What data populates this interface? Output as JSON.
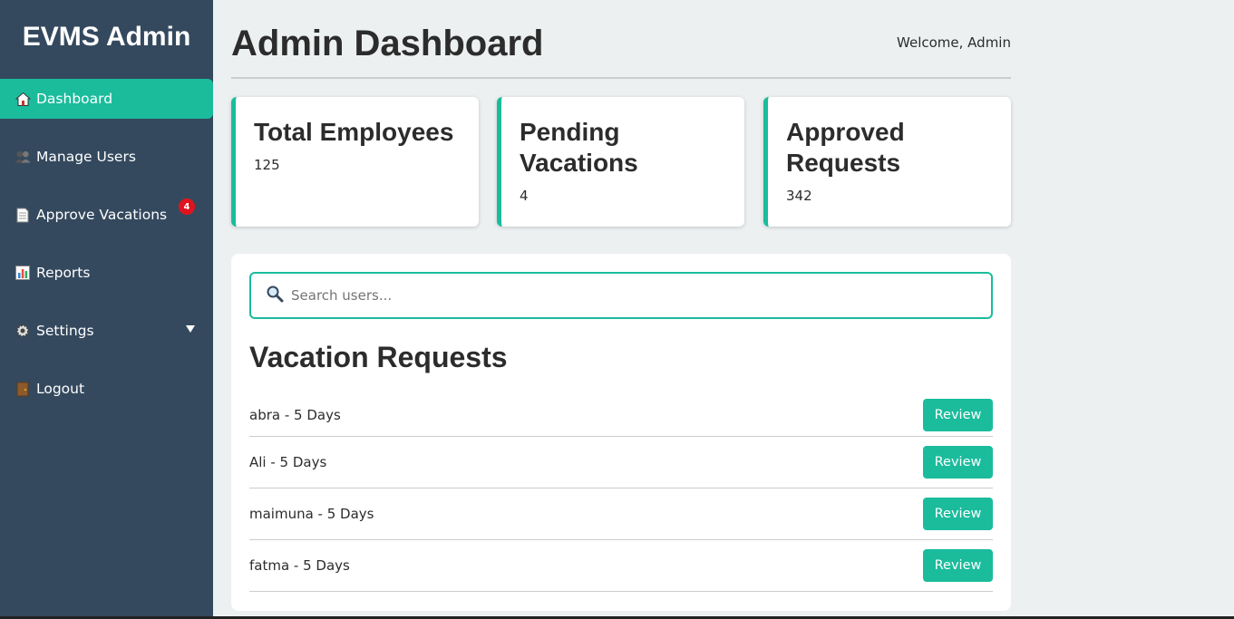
{
  "sidebar": {
    "brand": "EVMS Admin",
    "items": [
      {
        "label": "Dashboard",
        "icon": "home-icon"
      },
      {
        "label": "Manage Users",
        "icon": "users-icon"
      },
      {
        "label": "Approve Vacations",
        "icon": "document-icon",
        "badge": "4"
      },
      {
        "label": "Reports",
        "icon": "bar-chart-icon"
      },
      {
        "label": "Settings",
        "icon": "gear-icon"
      },
      {
        "label": "Logout",
        "icon": "door-icon"
      }
    ]
  },
  "header": {
    "title": "Admin Dashboard",
    "welcome": "Welcome, Admin"
  },
  "stats": [
    {
      "title": "Total Employees",
      "value": "125"
    },
    {
      "title": "Pending Vacations",
      "value": "4"
    },
    {
      "title": "Approved Requests",
      "value": "342"
    }
  ],
  "search": {
    "placeholder": "Search users..."
  },
  "requests": {
    "title": "Vacation Requests",
    "button_label": "Review",
    "rows": [
      {
        "text": "abra - 5 Days"
      },
      {
        "text": "Ali - 5 Days"
      },
      {
        "text": "maimuna - 5 Days"
      },
      {
        "text": "fatma - 5 Days"
      }
    ]
  },
  "colors": {
    "accent": "#1abc9c",
    "sidebar": "#34495e",
    "background": "#ecf0f1",
    "badge": "#e0141e"
  }
}
